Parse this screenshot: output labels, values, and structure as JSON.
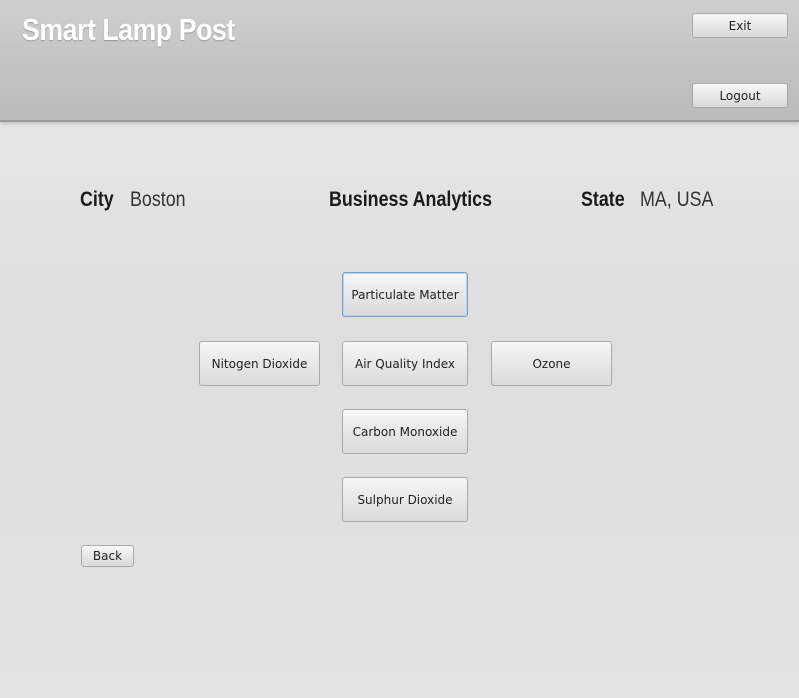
{
  "header": {
    "title": "Smart Lamp Post",
    "exit_label": "Exit",
    "logout_label": "Logout"
  },
  "info": {
    "city_label": "City",
    "city_value": "Boston",
    "section_title": "Business Analytics",
    "state_label": "State",
    "state_value": "MA, USA"
  },
  "metrics": {
    "particulate_matter": "Particulate Matter",
    "nitrogen_dioxide": "Nitogen Dioxide",
    "air_quality_index": "Air Quality Index",
    "ozone": "Ozone",
    "carbon_monoxide": "Carbon Monoxide",
    "sulphur_dioxide": "Sulphur Dioxide"
  },
  "footer": {
    "back_label": "Back"
  }
}
